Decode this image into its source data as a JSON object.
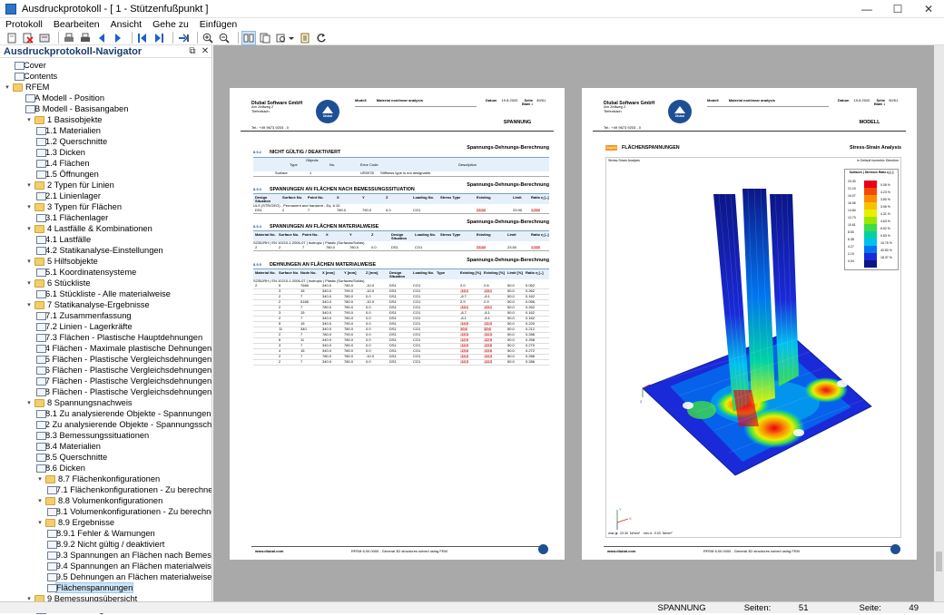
{
  "window": {
    "title": "Ausdruckprotokoll - [ 1 - Stützenfußpunkt ]",
    "minimize": "—",
    "maximize": "☐",
    "close": "✕"
  },
  "menu": [
    "Protokoll",
    "Bearbeiten",
    "Ansicht",
    "Gehe zu",
    "Einfügen"
  ],
  "navigator": {
    "title": "Ausdruckprotokoll-Navigator",
    "pin": "⧉",
    "close": "✕"
  },
  "tree": [
    {
      "label": "Cover",
      "depth": 1,
      "icon": "page"
    },
    {
      "label": "Contents",
      "depth": 1,
      "icon": "page"
    },
    {
      "label": "RFEM",
      "depth": 0,
      "icon": "folder",
      "exp": "▾"
    },
    {
      "label": "A Modell - Position",
      "depth": 2,
      "icon": "page"
    },
    {
      "label": "B Modell - Basisangaben",
      "depth": 2,
      "icon": "page"
    },
    {
      "label": "1 Basisobjekte",
      "depth": 2,
      "icon": "folder",
      "exp": "▾"
    },
    {
      "label": "1.1 Materialien",
      "depth": 3,
      "icon": "page"
    },
    {
      "label": "1.2 Querschnitte",
      "depth": 3,
      "icon": "page"
    },
    {
      "label": "1.3 Dicken",
      "depth": 3,
      "icon": "page"
    },
    {
      "label": "1.4 Flächen",
      "depth": 3,
      "icon": "page"
    },
    {
      "label": "1.5 Öffnungen",
      "depth": 3,
      "icon": "page"
    },
    {
      "label": "2 Typen für Linien",
      "depth": 2,
      "icon": "folder",
      "exp": "▾"
    },
    {
      "label": "2.1 Linienlager",
      "depth": 3,
      "icon": "page"
    },
    {
      "label": "3 Typen für Flächen",
      "depth": 2,
      "icon": "folder",
      "exp": "▾"
    },
    {
      "label": "3.1 Flächenlager",
      "depth": 3,
      "icon": "page"
    },
    {
      "label": "4 Lastfälle & Kombinationen",
      "depth": 2,
      "icon": "folder",
      "exp": "▾"
    },
    {
      "label": "4.1 Lastfälle",
      "depth": 3,
      "icon": "page"
    },
    {
      "label": "4.2 Statikanalyse-Einstellungen",
      "depth": 3,
      "icon": "page"
    },
    {
      "label": "5 Hilfsobjekte",
      "depth": 2,
      "icon": "folder",
      "exp": "▾"
    },
    {
      "label": "5.1 Koordinatensysteme",
      "depth": 3,
      "icon": "page"
    },
    {
      "label": "6 Stückliste",
      "depth": 2,
      "icon": "folder",
      "exp": "▾"
    },
    {
      "label": "6.1 Stückliste - Alle materialweise",
      "depth": 3,
      "icon": "page"
    },
    {
      "label": "7 Statikanalyse-Ergebnisse",
      "depth": 2,
      "icon": "folder",
      "exp": "▾"
    },
    {
      "label": "7.1 Zusammenfassung",
      "depth": 3,
      "icon": "page"
    },
    {
      "label": "7.2 Linien - Lagerkräfte",
      "depth": 3,
      "icon": "page"
    },
    {
      "label": "7.3 Flächen - Plastische Hauptdehnungen",
      "depth": 3,
      "icon": "page"
    },
    {
      "label": "7.4 Flächen - Maximale plastische Dehnungen",
      "depth": 3,
      "icon": "page"
    },
    {
      "label": "7.5 Flächen - Plastische Vergleichsdehnungen - von Mi...",
      "depth": 3,
      "icon": "page"
    },
    {
      "label": "7.6 Flächen - Plastische Vergleichsdehnungen - Tresca",
      "depth": 3,
      "icon": "page"
    },
    {
      "label": "7.7 Flächen - Plastische Vergleichsdehnungen - Rankine",
      "depth": 3,
      "icon": "page"
    },
    {
      "label": "7.8 Flächen - Plastische Vergleichsdehnungen - Bach",
      "depth": 3,
      "icon": "page"
    },
    {
      "label": "8 Spannungsnachweis",
      "depth": 2,
      "icon": "folder",
      "exp": "▾"
    },
    {
      "label": "8.1 Zu analysierende Objekte - Spannungen",
      "depth": 3,
      "icon": "page"
    },
    {
      "label": "8.2 Zu analysierende Objekte - Spannungsschwingbrei...",
      "depth": 3,
      "icon": "page"
    },
    {
      "label": "8.3 Bemessungssituationen",
      "depth": 3,
      "icon": "page"
    },
    {
      "label": "8.4 Materialien",
      "depth": 3,
      "icon": "page"
    },
    {
      "label": "8.5 Querschnitte",
      "depth": 3,
      "icon": "page"
    },
    {
      "label": "8.6 Dicken",
      "depth": 3,
      "icon": "page"
    },
    {
      "label": "8.7 Flächenkonfigurationen",
      "depth": 3,
      "icon": "folder",
      "exp": "▾"
    },
    {
      "label": "8.7.1 Flächenkonfigurationen - Zu berechnende D...",
      "depth": 4,
      "icon": "page"
    },
    {
      "label": "8.8 Volumenkonfigurationen",
      "depth": 3,
      "icon": "folder",
      "exp": "▾"
    },
    {
      "label": "8.8.1 Volumenkonfigurationen - Zu berechnende ...",
      "depth": 4,
      "icon": "page"
    },
    {
      "label": "8.9 Ergebnisse",
      "depth": 3,
      "icon": "folder",
      "exp": "▾"
    },
    {
      "label": "8.9.1 Fehler & Warnungen",
      "depth": 4,
      "icon": "page"
    },
    {
      "label": "8.9.2 Nicht gültig / deaktiviert",
      "depth": 4,
      "icon": "page"
    },
    {
      "label": "8.9.3 Spannungen an Flächen nach Bemessungssi...",
      "depth": 4,
      "icon": "page"
    },
    {
      "label": "8.9.4 Spannungen an Flächen materialweise",
      "depth": 4,
      "icon": "page"
    },
    {
      "label": "8.9.5 Dehnungen an Flächen materialweise",
      "depth": 4,
      "icon": "page"
    },
    {
      "label": "Flächenspannungen",
      "depth": 4,
      "icon": "page",
      "selected": true
    },
    {
      "label": "9 Bemessungsübersicht",
      "depth": 2,
      "icon": "folder",
      "exp": "▾"
    },
    {
      "label": "9.1 Bemessungsübersicht",
      "depth": 3,
      "icon": "page"
    }
  ],
  "page_left": {
    "company": "Dlubal Software GmbH",
    "address1": "Am Zellweg 2",
    "address2": "Tiefenbach",
    "phone": "Tel.: +49 9673 9203 - 0",
    "model_label": "Modell",
    "model_value": "Material nonlinear analysis",
    "date_label": "Datum",
    "date_value": "19.8.2020",
    "page_label": "Seite",
    "page_value": "49/51",
    "sheet_label": "Blatt",
    "sheet_value": "1",
    "header_tag": "SPANNUNG",
    "sec1_no": "8.9.2",
    "sec1_title": "NICHT GÜLTIG / DEAKTIVIERT",
    "sec1_right": "Spannungs-Dehnungs-Berechnung",
    "sec1_cols": [
      "Objects",
      "Type",
      "No.",
      "Error Code",
      "Description"
    ],
    "sec1_row": [
      "Surface",
      "1",
      "UR0078",
      "Stiffness type is not designable."
    ],
    "sec2_no": "8.9.3",
    "sec2_title": "SPANNUNGEN AN FLÄCHEN NACH BEMESSUNGSSITUATION",
    "sec2_right": "Spannungs-Dehnungs-Berechnung",
    "sec2_cols": [
      "Design Situation",
      "Surface No.",
      "Point No.",
      "X",
      "Y",
      "Z",
      "Loading No.",
      "Stress Type",
      "Existing",
      "Limit",
      "Ratio η [–]"
    ],
    "sec2_sub": "ULS (STR/GEO) - Permanent and transient - Eq. 6.10",
    "sec2_row": [
      "DS1",
      "2",
      "7",
      "780.0",
      "790.0",
      "0.0",
      "CO1",
      "",
      "23.50",
      "23.90",
      "1.000"
    ],
    "sec3_no": "8.9.4",
    "sec3_title": "SPANNUNGEN AN FLÄCHEN MATERIALWEISE",
    "sec3_right": "Spannungs-Dehnungs-Berechnung",
    "sec3_cols": [
      "Material No.",
      "Surface No.",
      "Point No.",
      "X",
      "Y",
      "Z",
      "Design Situation",
      "Loading No.",
      "Stress Type",
      "Existing",
      "Limit",
      "Ratio η [–]"
    ],
    "sec3_sub": "S235JRH | EN 10210-1:2006-07 | Isotropic | Plastic (Surfaces/Solids)",
    "sec3_row": [
      "2",
      "2",
      "7",
      "780.0",
      "780.0",
      "0.0",
      "DS1",
      "CO1",
      "",
      "23.50",
      "23.50",
      "1.000"
    ],
    "sec4_no": "8.9.5",
    "sec4_title": "DEHNUNGEN AN FLÄCHEN MATERIALWEISE",
    "sec4_right": "Spannungs-Dehnungs-Berechnung",
    "sec4_cols": [
      "Material No.",
      "Surface No.",
      "Node No.",
      "X [mm]",
      "Y [mm]",
      "Z [mm]",
      "Design Situation",
      "Loading No.",
      "Type",
      "Existing [%]",
      "Existing [%]",
      "Limit [%]",
      "Ratio η [–]"
    ],
    "sec4_sub": "S235JRH | EN 10210-1:2006-07 | Isotropic | Plastic (Surfaces/Solids)",
    "sec4_rows": [
      [
        "2",
        "5",
        "7666",
        "340.0",
        "780.0",
        "-10.0",
        "DS1",
        "CO1",
        "2.0",
        "2.6",
        "50.0",
        "0.052"
      ],
      [
        "",
        "3",
        "15",
        "340.0",
        "790.0",
        "-10.0",
        "DS1",
        "CO1",
        "-13.1",
        "-13.1",
        "50.0",
        "0.262"
      ],
      [
        "",
        "2",
        "7",
        "340.0",
        "780.0",
        "0.0",
        "DS1",
        "CO1",
        "-8.7",
        "-8.1",
        "50.0",
        "0.162"
      ],
      [
        "",
        "2",
        "5166",
        "340.0",
        "780.0",
        "-10.0",
        "DS1",
        "CO1",
        "2.9",
        "2.9",
        "50.0",
        "0.056"
      ],
      [
        "",
        "2",
        "7",
        "780.0",
        "780.0",
        "0.0",
        "DS1",
        "CO1",
        "-13.1",
        "-13.1",
        "50.0",
        "0.262"
      ],
      [
        "",
        "3",
        "15",
        "340.0",
        "790.0",
        "0.0",
        "DS1",
        "CO1",
        "-8.7",
        "-8.1",
        "50.0",
        "0.162"
      ],
      [
        "",
        "2",
        "7",
        "340.0",
        "780.0",
        "0.0",
        "DS1",
        "CO1",
        "-8.1",
        "-8.1",
        "50.0",
        "0.162"
      ],
      [
        "",
        "5",
        "15",
        "340.0",
        "790.0",
        "0.0",
        "DS1",
        "CO1",
        "-14.9",
        "-11.0",
        "50.0",
        "0.220"
      ],
      [
        "",
        "11",
        "340",
        "340.0",
        "780.0",
        "0.0",
        "DS1",
        "CO1",
        "10.6",
        "10.6",
        "50.0",
        "0.212"
      ],
      [
        "",
        "2",
        "7",
        "780.0",
        "790.0",
        "0.0",
        "DS1",
        "CO1",
        "-14.3",
        "-14.3",
        "50.0",
        "0.286"
      ],
      [
        "",
        "6",
        "11",
        "340.0",
        "780.0",
        "0.0",
        "DS1",
        "CO1",
        "-12.9",
        "-12.9",
        "50.0",
        "0.258"
      ],
      [
        "",
        "3",
        "7",
        "340.0",
        "780.0",
        "0.0",
        "DS1",
        "CO1",
        "-14.9",
        "-13.6",
        "50.0",
        "0.270"
      ],
      [
        "",
        "4",
        "15",
        "340.0",
        "780.0",
        "0.0",
        "DS1",
        "CO1",
        "-13.6",
        "-13.6",
        "50.0",
        "0.272"
      ],
      [
        "",
        "2",
        "7",
        "780.0",
        "780.0",
        "-10.0",
        "DS1",
        "CO1",
        "-14.3",
        "-14.3",
        "50.0",
        "0.286"
      ],
      [
        "",
        "2",
        "7",
        "340.0",
        "780.0",
        "0.0",
        "DS1",
        "CO1",
        "-14.3",
        "-14.3",
        "50.0",
        "0.286"
      ]
    ],
    "footer_url": "www.dlubal.com",
    "footer_text": "RFEM 6.00.0000 - General 3D structures solved using FEM"
  },
  "page_right": {
    "company": "Dlubal Software GmbH",
    "address1": "Am Zellweg 2",
    "address2": "Tiefenbach",
    "phone": "Tel.: +49 9673 9203 - 0",
    "model_label": "Modell",
    "model_value": "Material nonlinear analysis",
    "date_label": "Datum",
    "date_value": "19.8.2020",
    "page_label": "Seite",
    "page_value": "50/51",
    "sheet_label": "Blatt",
    "sheet_value": "1",
    "header_tag": "MODELL",
    "badge": "Graphic",
    "title": "FLÄCHENSPANNUNGEN",
    "title_right": "Stress-Strain Analysis",
    "box_left": "Stress-Strain Analysis",
    "box_right": "in Default Isometric Direction",
    "legend_title": "Surfaces | Stresses Ratio η [–]",
    "legend_values": [
      "23.30",
      "21.19",
      "19.07",
      "16.96",
      "14.84",
      "12.73",
      "10.61",
      "8.50",
      "6.38",
      "4.27",
      "2.15",
      "0.04"
    ],
    "legend_pct": [
      "0.08 %",
      "4.23 %",
      "3.80 %",
      "3.96 %",
      "4.31 %",
      "4.63 %",
      "6.52 %",
      "9.53 %",
      "15.75 %",
      "40.50 %",
      "18.37 %"
    ],
    "legend_colors": [
      "#e8001c",
      "#f24a00",
      "#fb8c00",
      "#f6c200",
      "#e6f000",
      "#9ce600",
      "#3ddc4a",
      "#00d3a3",
      "#00c0ee",
      "#0076f0",
      "#1a2ad8",
      "#0b1687"
    ],
    "bottom_note_label": "max σ:",
    "bottom_note": "23.30",
    "bottom_note_min_label": "min σ:",
    "bottom_note_min": "0.03",
    "bottom_note_unit": "N/mm²",
    "axis_x": "X",
    "axis_y": "Y",
    "axis_z": "Z",
    "footer_url": "www.dlubal.com",
    "footer_text": "RFEM 6.00.0000 - General 3D structures solved using FEM"
  },
  "status": {
    "mode": "SPANNUNG",
    "pages_label": "Seiten:",
    "pages": "51",
    "page_label": "Seite:",
    "page": "49"
  }
}
